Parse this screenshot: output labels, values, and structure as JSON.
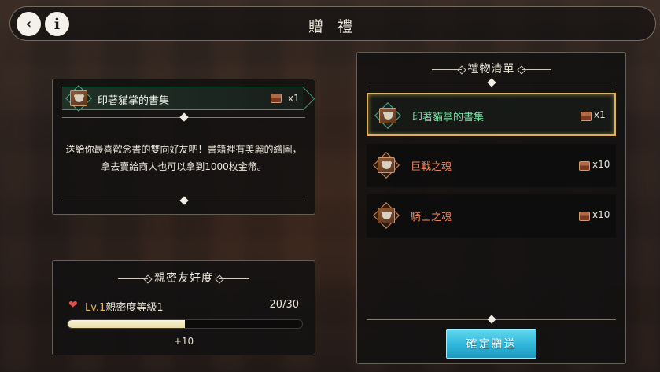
{
  "header": {
    "title": "贈 禮"
  },
  "gift_detail": {
    "item_name": "印著貓掌的書集",
    "quantity": "x1",
    "description": "送給你最喜歡念書的雙向好友吧！書籍裡有美麗的繪圖，拿去賣給商人也可以拿到1000枚金幣。",
    "icons": {
      "item": "cat-paw-book-icon",
      "chest": "gift-chest-icon"
    }
  },
  "friendship": {
    "title": "親密友好度",
    "level_label": "Lv.1",
    "level_desc": "親密度等級1",
    "count": "20/30",
    "progress_fraction": 0.5,
    "gain": "+10",
    "heart_icon": "heart-icon"
  },
  "gift_list": {
    "title": "禮物清單",
    "items": [
      {
        "name": "印著貓掌的書集",
        "qty": "x1",
        "selected": true,
        "color": "#74e2a4"
      },
      {
        "name": "巨戰之魂",
        "qty": "x10",
        "selected": false,
        "color": "#f08b60"
      },
      {
        "name": "騎士之魂",
        "qty": "x10",
        "selected": false,
        "color": "#f08b60"
      }
    ],
    "confirm_label": "確定贈送"
  },
  "colors": {
    "accent": "#2fb6da",
    "rare_green": "#74e2a4",
    "rare_orange": "#f08b60",
    "level_gold": "#e8b75a"
  }
}
